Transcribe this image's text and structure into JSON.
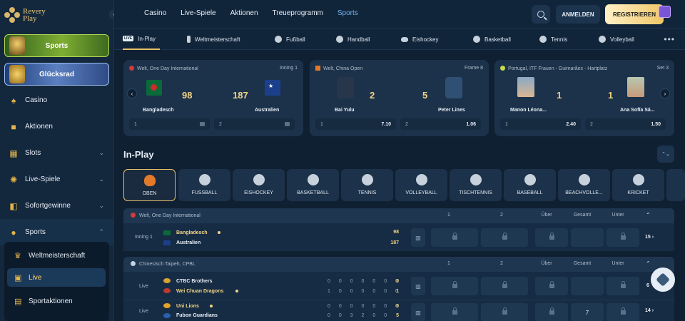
{
  "brand": {
    "line1": "Revery",
    "line2": "Play"
  },
  "sidebar": {
    "promos": [
      {
        "label": "Sports"
      },
      {
        "label": "Glücksrad"
      }
    ],
    "items": [
      {
        "label": "Casino",
        "icon": "spade-icon",
        "chevron": false
      },
      {
        "label": "Aktionen",
        "icon": "gift-icon",
        "chevron": false
      },
      {
        "label": "Slots",
        "icon": "slots-icon",
        "chevron": true
      },
      {
        "label": "Live-Spiele",
        "icon": "roulette-icon",
        "chevron": true
      },
      {
        "label": "Sofortgewinne",
        "icon": "gamepad-icon",
        "chevron": true
      },
      {
        "label": "Sports",
        "icon": "football-icon",
        "chevron": true
      }
    ],
    "subitems": [
      {
        "label": "Weltmeisterschaft",
        "icon": "trophy-icon"
      },
      {
        "label": "Live",
        "icon": "live-icon",
        "active": true
      },
      {
        "label": "Sportaktionen",
        "icon": "ticket-icon"
      }
    ]
  },
  "topnav": {
    "items": [
      "Casino",
      "Live-Spiele",
      "Aktionen",
      "Treueprogramm",
      "Sports"
    ],
    "active": "Sports",
    "login": "ANMELDEN",
    "register": "REGISTRIEREN"
  },
  "sporttabs": [
    {
      "label": "In-Play",
      "icon": "live-icon",
      "active": true
    },
    {
      "label": "Weltmeisterschaft",
      "icon": "trophy-icon"
    },
    {
      "label": "Fußball",
      "icon": "football-icon"
    },
    {
      "label": "Handball",
      "icon": "handball-icon"
    },
    {
      "label": "Eishockey",
      "icon": "puck-icon"
    },
    {
      "label": "Basketball",
      "icon": "basketball-icon"
    },
    {
      "label": "Tennis",
      "icon": "tennis-icon"
    },
    {
      "label": "Volleyball",
      "icon": "volleyball-icon"
    }
  ],
  "featured": [
    {
      "league": "Welt, One Day International",
      "period": "Inning 1",
      "home": "Bangladesch",
      "away": "Australien",
      "home_score": "98",
      "away_score": "187",
      "odd1_label": "1",
      "odd1": "",
      "odd2_label": "2",
      "odd2": ""
    },
    {
      "league": "Welt, China Open",
      "period": "Frame 8",
      "home": "Bai Yulu",
      "away": "Peter Lines",
      "home_score": "2",
      "away_score": "5",
      "odd1_label": "1",
      "odd1": "7.10",
      "odd2_label": "2",
      "odd2": "1.06"
    },
    {
      "league": "Portugal, ITF Frauen - Guimarães - Hartplatz",
      "period": "Set 3",
      "home": "Manon Léona...",
      "away": "Ana Sofía Sá...",
      "home_score": "1",
      "away_score": "1",
      "odd1_label": "1",
      "odd1": "2.40",
      "odd2_label": "2",
      "odd2": "1.50"
    }
  ],
  "inplay": {
    "title": "In-Play",
    "categories": [
      "OBEN",
      "FUSSBALL",
      "EISHOCKEY",
      "BASKETBALL",
      "TENNIS",
      "VOLLEYBALL",
      "TISCHTENNIS",
      "BASEBALL",
      "BEACHVOLLE...",
      "KRICKET"
    ],
    "col_headers": [
      "1",
      "2",
      "Über",
      "Gesamt",
      "Unter"
    ],
    "leagues": [
      {
        "name": "Welt, One Day International",
        "matches": [
          {
            "status": "Inning 1",
            "home": "Bangladesch",
            "away": "Australien",
            "home_score": "98",
            "away_score": "187",
            "more": "15"
          }
        ]
      },
      {
        "name": "Chinesisch Taipeh, CPBL",
        "matches": [
          {
            "status": "Live",
            "home": "CTBC Brothers",
            "away": "Wei Chuan Dragons",
            "home_innings": "0 0 0 0 0 0 0",
            "away_innings": "1 0 0 0 0 0 0",
            "home_score": "0",
            "away_score": "1",
            "more": "6"
          },
          {
            "status": "Live",
            "home": "Uni Lions",
            "away": "Fubon Guardians",
            "home_innings": "0 0 0 0 0 0 0",
            "away_innings": "0 0 3 2 0 0",
            "home_score": "0",
            "away_score": "5",
            "total": "7",
            "more": "14"
          }
        ]
      }
    ]
  }
}
